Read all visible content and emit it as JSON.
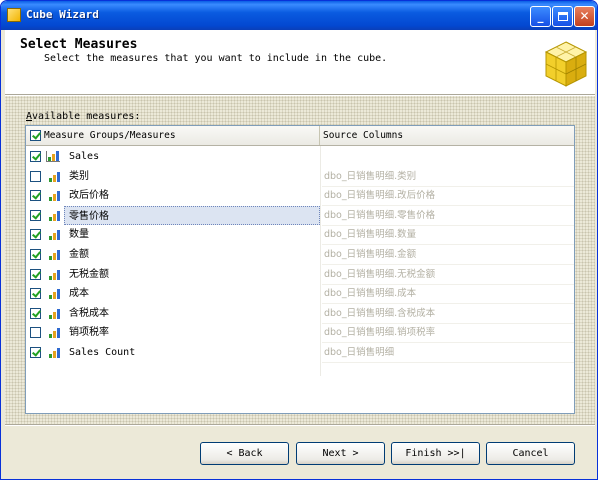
{
  "window": {
    "title": "Cube Wizard"
  },
  "header": {
    "title": "Select Measures",
    "description": "Select the measures that you want to include in the cube."
  },
  "available_label_prefix": "A",
  "available_label_rest": "vailable measures:",
  "grid": {
    "columns": [
      "Measure Groups/Measures",
      "Source Columns"
    ],
    "rows": [
      {
        "name": "Sales",
        "source": "",
        "checked": true,
        "group": true
      },
      {
        "name": "类别",
        "source": "dbo_日销售明细.类别",
        "checked": false
      },
      {
        "name": "改后价格",
        "source": "dbo_日销售明细.改后价格",
        "checked": true
      },
      {
        "name": "零售价格",
        "source": "dbo_日销售明细.零售价格",
        "checked": true,
        "selected": true
      },
      {
        "name": "数量",
        "source": "dbo_日销售明细.数量",
        "checked": true
      },
      {
        "name": "金额",
        "source": "dbo_日销售明细.金额",
        "checked": true
      },
      {
        "name": "无税金额",
        "source": "dbo_日销售明细.无税金额",
        "checked": true
      },
      {
        "name": "成本",
        "source": "dbo_日销售明细.成本",
        "checked": true
      },
      {
        "name": "含税成本",
        "source": "dbo_日销售明细.含税成本",
        "checked": true
      },
      {
        "name": "销项税率",
        "source": "dbo_日销售明细.销项税率",
        "checked": false
      },
      {
        "name": "Sales Count",
        "source": "dbo_日销售明细",
        "checked": true
      }
    ]
  },
  "buttons": {
    "back": "< Back",
    "next": "Next >",
    "finish": "Finish >>|",
    "cancel": "Cancel"
  }
}
